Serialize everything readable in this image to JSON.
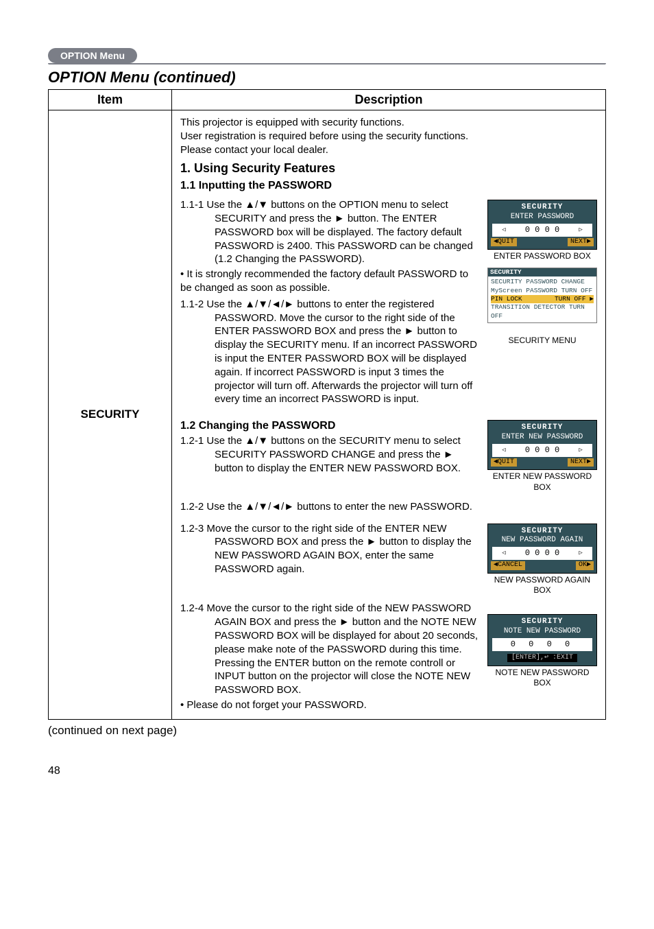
{
  "header": {
    "tab": "OPTION Menu",
    "title": "OPTION Menu (continued)"
  },
  "table": {
    "col_item": "Item",
    "col_desc": "Description",
    "item_name": "SECURITY",
    "intro": "This projector is equipped with security functions.\nUser registration is required before using the security functions.\nPlease contact your local dealer.",
    "sec1_title": "1. Using Security Features",
    "sec11_title": "1.1 Inputting the PASSWORD",
    "sec111": "1.1-1 Use the ▲/▼ buttons on the OPTION menu to select SECURITY and press the ► button. The ENTER PASSWORD box will be displayed. The factory default PASSWORD is 2400. This PASSWORD can be changed (1.2 Changing the PASSWORD).",
    "sec111_note": "• It is strongly recommended the factory default PASSWORD to be changed as soon as possible.",
    "sec112": "1.1-2 Use the ▲/▼/◄/► buttons to enter the registered PASSWORD. Move the cursor to the right side of the ENTER PASSWORD BOX and press the ► button to display the SECURITY menu. If an incorrect PASSWORD is input the ENTER PASSWORD BOX will be displayed again. If incorrect PASSWORD is input 3 times the projector will turn off. Afterwards the projector will turn off every time an incorrect PASSWORD is input.",
    "sec12_title": "1.2 Changing the PASSWORD",
    "sec121": "1.2-1 Use the ▲/▼ buttons on the SECURITY menu to select SECURITY PASSWORD CHANGE and press the ► button to display the ENTER NEW PASSWORD BOX.",
    "sec122": "1.2-2 Use the ▲/▼/◄/► buttons to enter the new PASSWORD.",
    "sec123": "1.2-3 Move the cursor to the right side of the ENTER NEW PASSWORD BOX and press the ► button to display the NEW PASSWORD AGAIN BOX, enter the same PASSWORD again.",
    "sec124": "1.2-4 Move the cursor to the right side of the NEW PASSWORD AGAIN BOX and press the ► button and the NOTE NEW PASSWORD BOX will be displayed for about 20 seconds, please make note of the PASSWORD during this time. Pressing the ENTER button on the remote controll or INPUT button on the projector will close the NOTE NEW PASSWORD BOX.",
    "sec124_note": "• Please do not forget your PASSWORD."
  },
  "osd": {
    "enter_pw": {
      "title": "SECURITY",
      "sub": "ENTER PASSWORD",
      "digits": "0  0  0  0",
      "left": "◀QUIT",
      "right": "NEXT▶",
      "caption": "ENTER PASSWORD BOX"
    },
    "sec_menu": {
      "hd": "SECURITY",
      "l1": "SECURITY PASSWORD CHANGE",
      "l2": "MyScreen PASSWORD TURN OFF",
      "l3a": "PIN LOCK",
      "l3b": "TURN OFF ▶",
      "l4": "TRANSITION DETECTOR TURN OFF",
      "caption": "SECURITY MENU"
    },
    "enter_new": {
      "title": "SECURITY",
      "sub": "ENTER NEW PASSWORD",
      "digits": "0  0  0  0",
      "left": "◀QUIT",
      "right": "NEXT▶",
      "caption": "ENTER NEW PASSWORD BOX"
    },
    "again": {
      "title": "SECURITY",
      "sub": "NEW PASSWORD AGAIN",
      "digits": "0  0  0  0",
      "left": "◀CANCEL",
      "right": "OK▶",
      "caption": "NEW PASSWORD AGAIN BOX"
    },
    "note": {
      "title": "SECURITY",
      "sub": "NOTE NEW PASSWORD",
      "digits": "0 0 0 0",
      "btn": "[ENTER],↩ :EXIT",
      "caption": "NOTE NEW PASSWORD BOX"
    }
  },
  "continued": "(continued on next page)",
  "page_number": "48"
}
